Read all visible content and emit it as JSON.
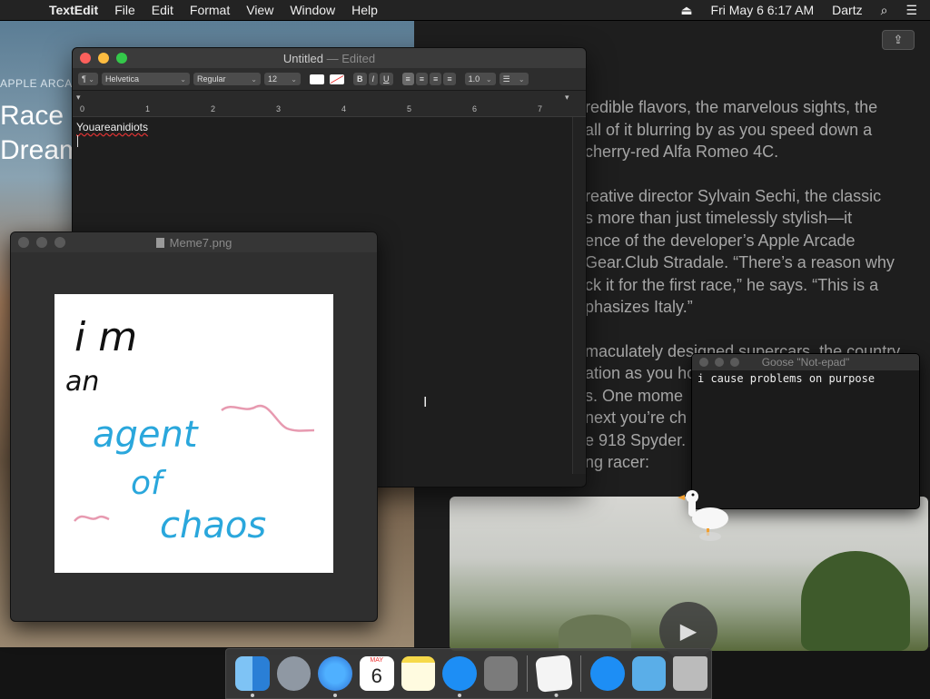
{
  "menubar": {
    "apple_icon": "apple-logo-icon",
    "app_name": "TextEdit",
    "items": [
      "File",
      "Edit",
      "Format",
      "View",
      "Window",
      "Help"
    ],
    "datetime": "Fri May 6  6:17 AM",
    "user": "Dartz",
    "eject_glyph": "⏏",
    "search_glyph": "⌕",
    "list_glyph": "☰"
  },
  "article": {
    "left_label": "APPLE ARCADE",
    "left_title_line1": "Race a",
    "left_title_line2": "Dream",
    "para1": [
      "redible flavors, the marvelous sights, the",
      "all of it blurring by as you speed down a",
      "cherry-red Alfa Romeo 4C."
    ],
    "para2": [
      "reative director Sylvain Sechi, the classic",
      "s more than just timelessly stylish—it",
      "ence of the developer’s Apple Arcade",
      " Gear.Club Stradale. “There’s a reason why",
      "ck it for the first race,” he says. “This is a",
      "phasizes Italy.”"
    ],
    "para3": [
      "maculately designed supercars, the country",
      "ation as you ho",
      "s. One mome",
      "next you’re ch",
      "e 918 Spyder.",
      "ng racer:"
    ],
    "share_glyph": "⇪",
    "play_glyph": "▶"
  },
  "textedit": {
    "title": "Untitled",
    "title_sep": " — ",
    "title_status": "Edited",
    "toolbar": {
      "paragraph": "¶",
      "font": "Helvetica",
      "style": "Regular",
      "size": "12",
      "bold": "B",
      "italic": "I",
      "underline": "U",
      "align_left": "≡",
      "align_center": "≡",
      "align_right": "≡",
      "align_justify": "≡",
      "spacing": "1.0",
      "list": "☰",
      "arrow": "⌄"
    },
    "ruler_numbers": [
      "0",
      "1",
      "2",
      "3",
      "4",
      "5",
      "6",
      "7"
    ],
    "body_text": "Youareanidiots"
  },
  "image_viewer": {
    "title": "Meme7.png",
    "drawing_text": [
      "i m",
      "an",
      "agent",
      "of",
      "chaos"
    ],
    "colors": {
      "ink_black": "#111111",
      "ink_blue": "#2aa7dc",
      "ink_pink": "#e79ab0"
    }
  },
  "goose_notepad": {
    "title": "Goose \"Not-epad\"",
    "note": "i cause problems on purpose"
  },
  "dock": {
    "calendar_month": "MAY",
    "calendar_day": "6",
    "items": [
      "finder-icon",
      "launchpad-icon",
      "safari-icon",
      "calendar-icon",
      "notes-icon",
      "app-store-icon",
      "system-preferences-icon",
      "textedit-icon",
      "applications-folder-icon",
      "documents-folder-icon",
      "trash-icon"
    ]
  }
}
